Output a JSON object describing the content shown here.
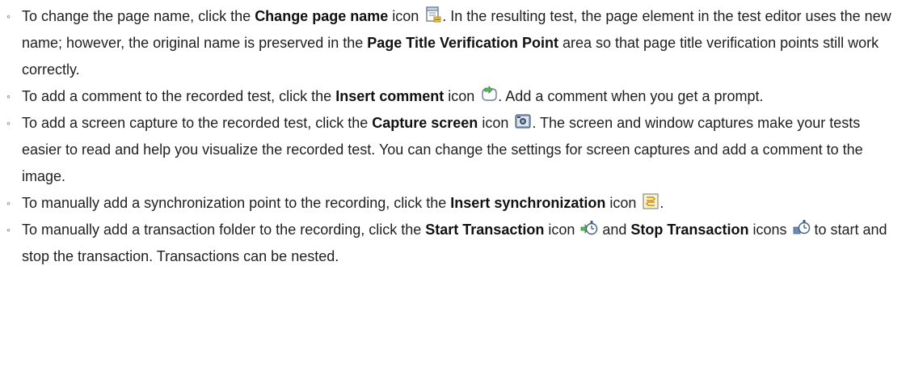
{
  "items": [
    {
      "pre": "To change the page name, click the ",
      "bold1": "Change page name",
      "mid": " icon",
      "icon": "change-page-name-icon",
      "post": ". In the resulting test, the page element in the test editor uses the new name; however, the original name is preserved in the ",
      "bold2": "Page Title Verification Point",
      "post2": " area so that page title verification points still work correctly."
    },
    {
      "pre": "To add a comment to the recorded test, click the ",
      "bold1": "Insert comment",
      "mid": " icon",
      "icon": "insert-comment-icon",
      "post": ". Add a comment when you get a prompt."
    },
    {
      "pre": "To add a screen capture to the recorded test, click the ",
      "bold1": "Capture screen",
      "mid": " icon",
      "icon": "capture-screen-icon",
      "post": ". The screen and window captures make your tests easier to read and help you visualize the recorded test. You can change the settings for screen captures and add a comment to the image."
    },
    {
      "pre": "To manually add a synchronization point to the recording, click the ",
      "bold1": "Insert synchronization",
      "mid": " icon",
      "icon": "insert-synchronization-icon",
      "post": "."
    },
    {
      "pre": "To manually add a transaction folder to the recording, click the ",
      "bold1": "Start Transaction",
      "mid": " icon",
      "icon": "start-transaction-icon",
      "post": " and ",
      "bold2": "Stop Transaction",
      "mid2": " icons",
      "icon2": "stop-transaction-icon",
      "post2": " to start and stop the transaction. Transactions can be nested."
    }
  ],
  "bullet": "◦"
}
